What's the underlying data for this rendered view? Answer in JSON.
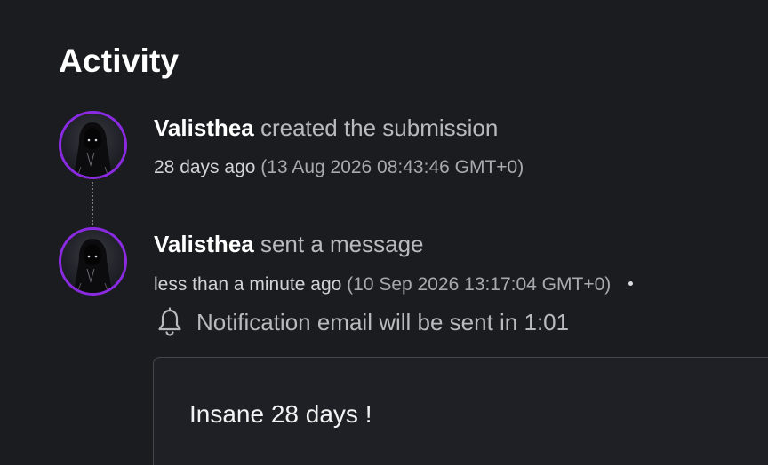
{
  "activity": {
    "title": "Activity",
    "events": [
      {
        "user": "Valisthea",
        "action": "created the submission",
        "relative_time": "28 days ago",
        "absolute_time": "(13 Aug 2026 08:43:46 GMT+0)"
      },
      {
        "user": "Valisthea",
        "action": "sent a message",
        "relative_time": "less than a minute ago",
        "absolute_time": "(10 Sep 2026 13:17:04 GMT+0)",
        "notification": "Notification email will be sent in 1:01",
        "message": "Insane 28 days !"
      }
    ]
  },
  "colors": {
    "background": "#1b1c20",
    "avatar_ring": "#8a2be2",
    "text_primary": "#ffffff",
    "text_secondary": "#b9b9bf"
  },
  "icons": {
    "avatar": "hooded-figure-avatar",
    "notification": "bell-icon"
  }
}
